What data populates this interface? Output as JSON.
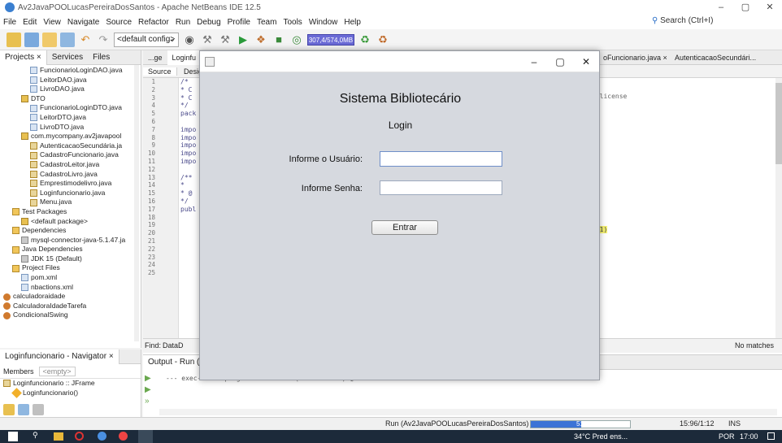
{
  "window": {
    "title": "Av2JavaPOOLucasPereiraDosSantos - Apache NetBeans IDE 12.5",
    "minimize": "–",
    "maximize": "▢",
    "close": "✕"
  },
  "menu": [
    "File",
    "Edit",
    "View",
    "Navigate",
    "Source",
    "Refactor",
    "Run",
    "Debug",
    "Profile",
    "Team",
    "Tools",
    "Window",
    "Help"
  ],
  "search": {
    "label": "Search (Ctrl+I)"
  },
  "toolbar": {
    "config": "<default config>",
    "memory": "307,4/574,0MB"
  },
  "projects": {
    "tabs": [
      "Projects ×",
      "Services",
      "Files"
    ],
    "items": [
      {
        "label": "FuncionarioLoginDAO.java",
        "icon": "file",
        "indent": 3
      },
      {
        "label": "LeitorDAO.java",
        "icon": "file",
        "indent": 3
      },
      {
        "label": "LivroDAO.java",
        "icon": "file",
        "indent": 3
      },
      {
        "label": "DTO",
        "icon": "pkg",
        "indent": 2
      },
      {
        "label": "FuncionarioLoginDTO.java",
        "icon": "file",
        "indent": 3
      },
      {
        "label": "LeitorDTO.java",
        "icon": "file",
        "indent": 3
      },
      {
        "label": "LivroDTO.java",
        "icon": "file",
        "indent": 3
      },
      {
        "label": "com.mycompany.av2javapool",
        "icon": "pkg",
        "indent": 2
      },
      {
        "label": "AutenticacaoSecundária.ja",
        "icon": "form",
        "indent": 3
      },
      {
        "label": "CadastroFuncionario.java",
        "icon": "form",
        "indent": 3
      },
      {
        "label": "CadastroLeitor.java",
        "icon": "form",
        "indent": 3
      },
      {
        "label": "CadastroLivro.java",
        "icon": "form",
        "indent": 3
      },
      {
        "label": "Emprestimodelivro.java",
        "icon": "form",
        "indent": 3
      },
      {
        "label": "Loginfuncionario.java",
        "icon": "form",
        "indent": 3
      },
      {
        "label": "Menu.java",
        "icon": "form",
        "indent": 3
      },
      {
        "label": "Test Packages",
        "icon": "folder",
        "indent": 1
      },
      {
        "label": "<default package>",
        "icon": "pkg",
        "indent": 2
      },
      {
        "label": "Dependencies",
        "icon": "folder",
        "indent": 1
      },
      {
        "label": "mysql-connector-java-5.1.47.ja",
        "icon": "jar",
        "indent": 2
      },
      {
        "label": "Java Dependencies",
        "icon": "folder",
        "indent": 1
      },
      {
        "label": "JDK 15 (Default)",
        "icon": "jar",
        "indent": 2
      },
      {
        "label": "Project Files",
        "icon": "folder",
        "indent": 1
      },
      {
        "label": "pom.xml",
        "icon": "file",
        "indent": 2
      },
      {
        "label": "nbactions.xml",
        "icon": "file",
        "indent": 2
      },
      {
        "label": "calculadoraidade",
        "icon": "proj",
        "indent": 0
      },
      {
        "label": "CalculadoraIdadeTarefa",
        "icon": "proj",
        "indent": 0
      },
      {
        "label": "CondicionalSwing",
        "icon": "proj",
        "indent": 0
      }
    ]
  },
  "navigator": {
    "title": "Loginfuncionario - Navigator ×",
    "filter": "Members",
    "empty": "<empty>",
    "items": [
      "Loginfuncionario :: JFrame",
      "Loginfuncionario()"
    ]
  },
  "editor": {
    "tabs": [
      "...ge",
      "Loginfu",
      "oFuncionario.java ×",
      "AutenticacaoSecundári..."
    ],
    "subtabs": [
      "Source",
      "Design"
    ],
    "line_numbers": [
      "1",
      "2",
      "3",
      "4",
      "5",
      "6",
      "7",
      "8",
      "9",
      "10",
      "11",
      "12",
      "13",
      "14",
      "15",
      "16",
      "17",
      "18",
      "19",
      "20",
      "21",
      "22",
      "23",
      "24",
      "25"
    ],
    "code_fragments": [
      "/*",
      "* C",
      "* C",
      "*/",
      "pack",
      "",
      "impo",
      "impo",
      "impo",
      "impo",
      "impo",
      "",
      "/**",
      "*",
      "* @",
      "*/",
      "publ"
    ],
    "license_text": "s license",
    "highlight_text": "691)",
    "find_label": "Find:",
    "find_value": "DataD",
    "no_matches": "No matches"
  },
  "output": {
    "title": "Output - Run (",
    "line": "--- exec-maven-plugin:3.0.0:exec (default-cli) @ Av2JavaPOOLucasPereiraDosSantos ---"
  },
  "status": {
    "run": "Run (Av2JavaPOOLucasPereiraDosSantos)",
    "progress_label": "51%",
    "progress": 0.51,
    "position": "15:96/1:12",
    "mode": "INS"
  },
  "taskbar": {
    "weather": "34°C Pred ens...",
    "lang": "POR",
    "time": "17:00"
  },
  "dialog": {
    "title": "",
    "heading": "Sistema Bibliotecário",
    "subheading": "Login",
    "user_label": "Informe o Usuário:",
    "pass_label": "Informe Senha:",
    "user_value": "",
    "pass_value": "",
    "button": "Entrar"
  }
}
